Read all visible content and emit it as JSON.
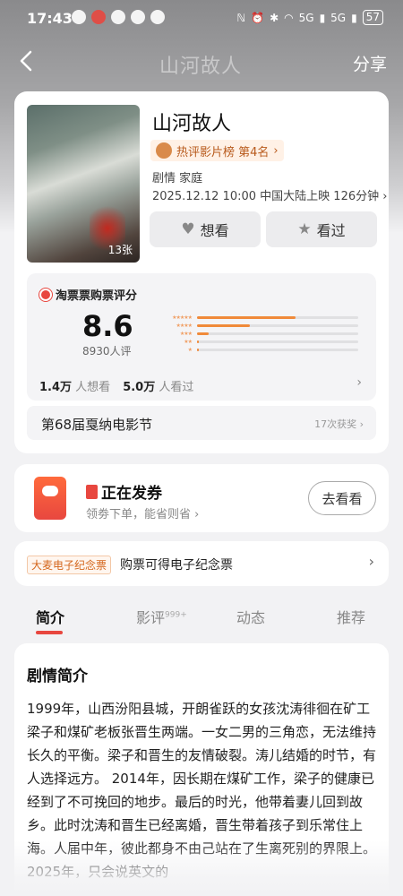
{
  "status_bar": {
    "time": "17:43",
    "network": "5G",
    "network2": "5G",
    "battery": "57"
  },
  "nav": {
    "title": "山河故人",
    "share": "分享"
  },
  "movie": {
    "title": "山河故人",
    "rank": "热评影片榜 第4名",
    "genre": "剧情 家庭",
    "release": "2025.12.12 10:00 中国大陆上映 126分钟",
    "poster_count": "13张",
    "want_button": "想看",
    "seen_button": "看过"
  },
  "rating": {
    "source": "淘票票购票评分",
    "score": "8.6",
    "count": "8930人评",
    "star_labels": [
      "★★★★★",
      "★★★★",
      "★★★",
      "★★",
      "★"
    ],
    "distribution": [
      0.61,
      0.33,
      0.07,
      0.01,
      0.01
    ],
    "want_count": "1.4万",
    "want_label": "人想看",
    "seen_count": "5.0万",
    "seen_label": "人看过"
  },
  "festival": {
    "name": "第68届戛纳电影节",
    "awards": "17次获奖"
  },
  "coupon": {
    "title": "正在发券",
    "subtitle": "领劵下单，能省则省",
    "button": "去看看"
  },
  "ticket": {
    "badge": "大麦电子纪念票",
    "text": "购票可得电子纪念票"
  },
  "tabs": [
    {
      "label": "简介",
      "badge": ""
    },
    {
      "label": "影评",
      "badge": "999+"
    },
    {
      "label": "动态",
      "badge": ""
    },
    {
      "label": "推荐",
      "badge": ""
    }
  ],
  "synopsis": {
    "title": "剧情简介",
    "body": "1999年，山西汾阳县城，开朗雀跃的女孩沈涛徘徊在矿工梁子和煤矿老板张晋生两端。一女二男的三角恋，无法维持长久的平衡。梁子和晋生的友情破裂。涛儿结婚的时节，有人选择远方。 2014年，因长期在煤矿工作，梁子的健康已经到了不可挽回的地步。最后的时光，他带着妻儿回到故乡。此时沈涛和晋生已经离婚，晋生带着孩子到乐常住上海。人届中年，彼此都身不由己站在了生离死别的界限上。2025年，只会说英文的"
  }
}
